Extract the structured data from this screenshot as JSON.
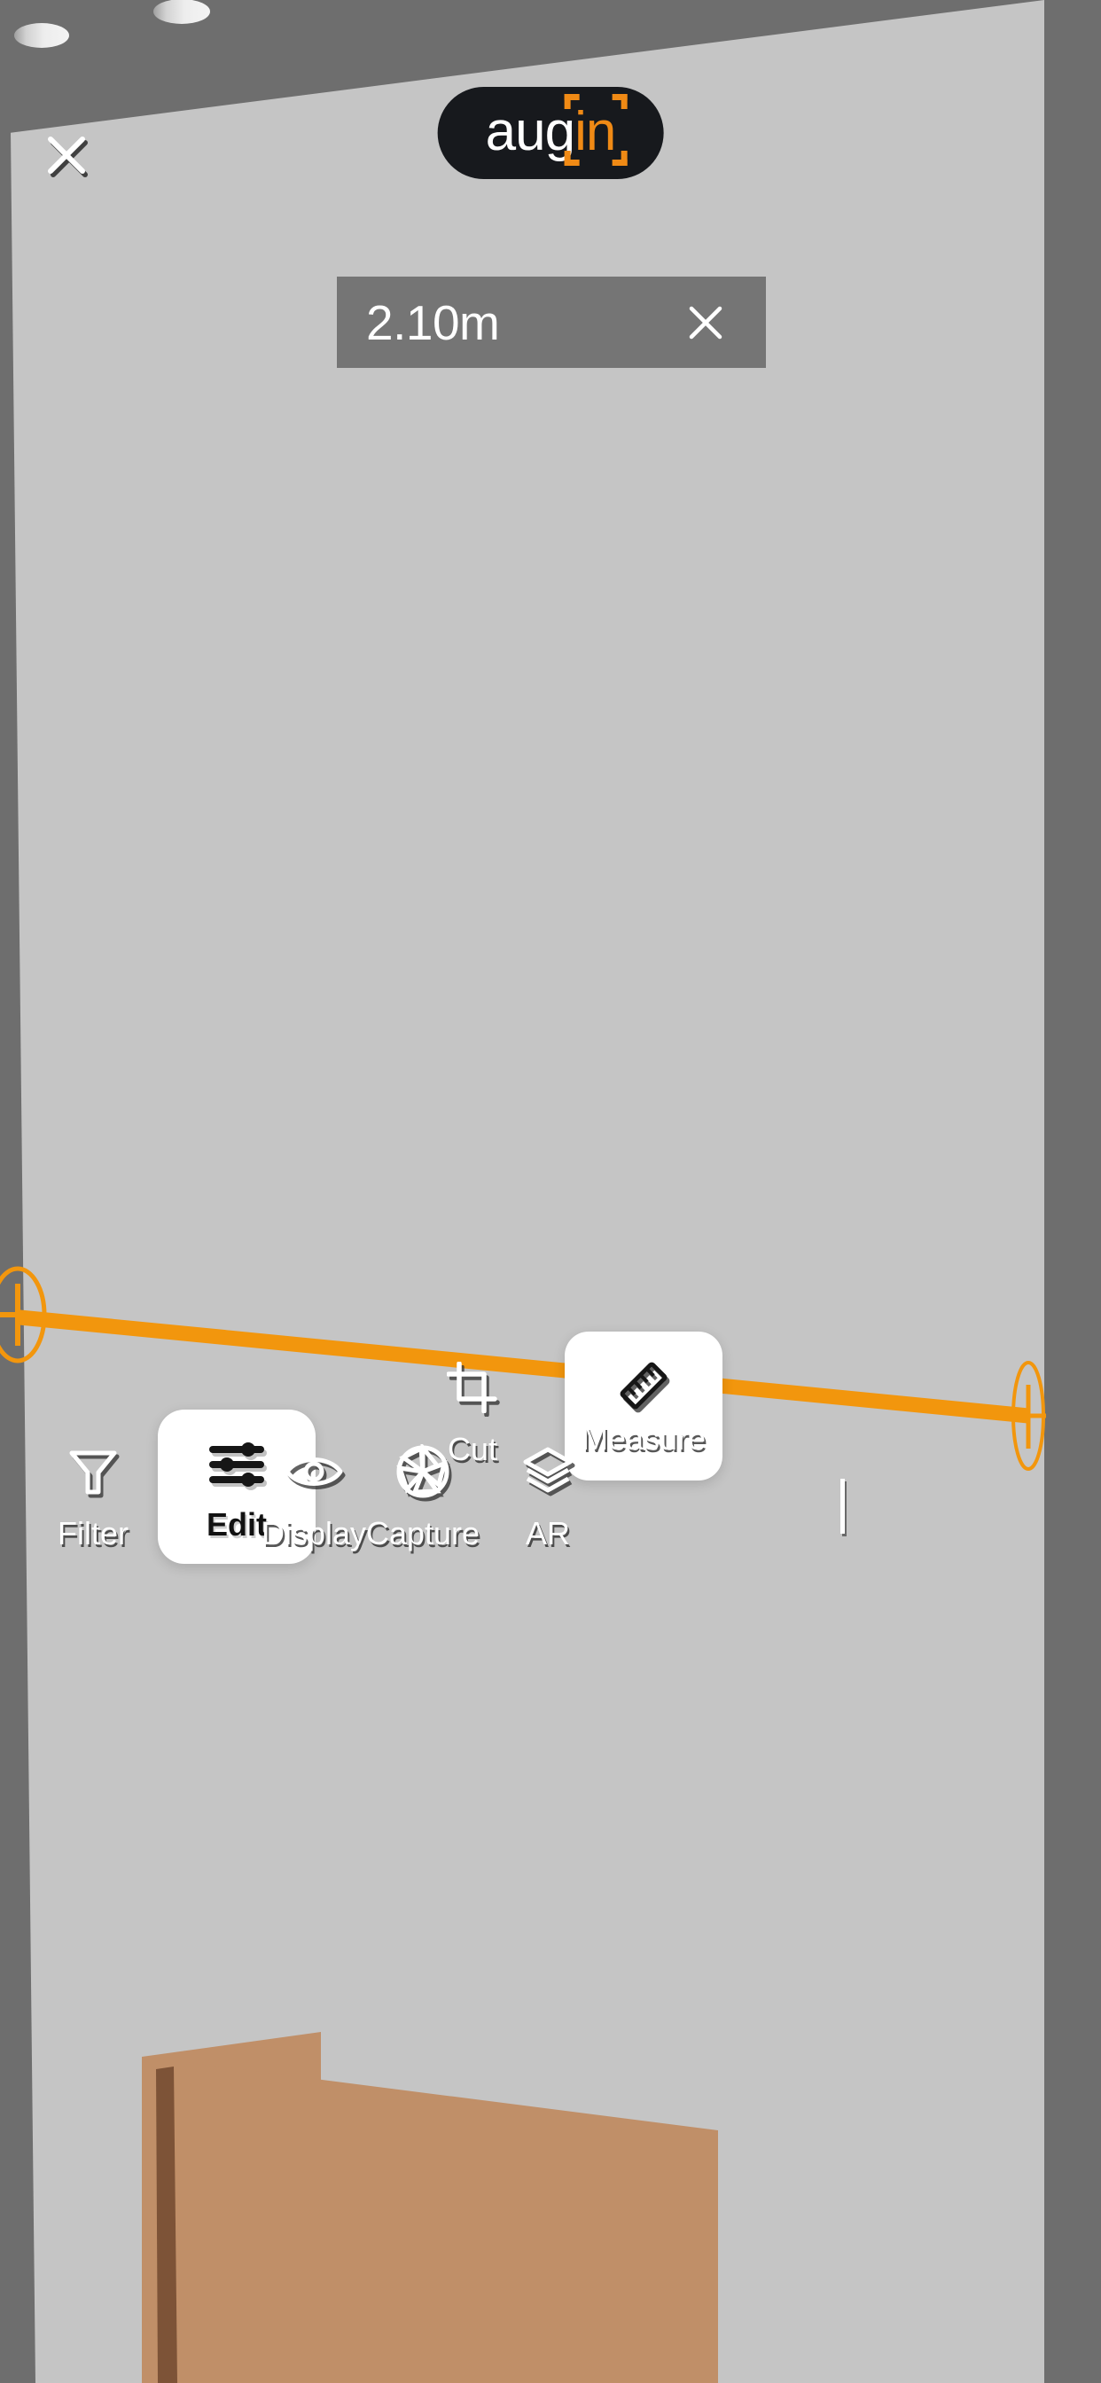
{
  "app": {
    "brand_prefix": "aug",
    "brand_suffix": "in",
    "accent_color": "#f08a15",
    "brand_bg": "#17191d"
  },
  "header": {
    "close_label": "close-icon"
  },
  "measurement": {
    "value": "2.10m",
    "value_number": 2.1,
    "unit": "m",
    "close_label": "close-icon",
    "line_color": "#f2960d"
  },
  "toolbar_secondary": {
    "items": [
      {
        "id": "cut",
        "label": "Cut",
        "icon": "crop-icon",
        "active": false
      },
      {
        "id": "measure",
        "label": "Measure",
        "icon": "ruler-icon",
        "active": true
      }
    ]
  },
  "toolbar_main": {
    "items": [
      {
        "id": "filter",
        "label": "Filter",
        "icon": "funnel-icon",
        "active": false
      },
      {
        "id": "edit",
        "label": "Edit",
        "icon": "sliders-icon",
        "active": true
      },
      {
        "id": "display",
        "label": "Display",
        "icon": "eye-icon",
        "active": false
      },
      {
        "id": "capture",
        "label": "Capture",
        "icon": "aperture-icon",
        "active": false
      },
      {
        "id": "ar",
        "label": "AR",
        "icon": "layers-icon",
        "active": false
      }
    ]
  },
  "scene": {
    "wall_color": "#c5c5c5",
    "ceiling_color": "#6e6e6e",
    "side_wall_color": "#6e6e6e",
    "door_color": "#c08f68",
    "door_jamb_color": "#7d5337",
    "light_color": "#e8e8e8",
    "lights_count": 2
  }
}
